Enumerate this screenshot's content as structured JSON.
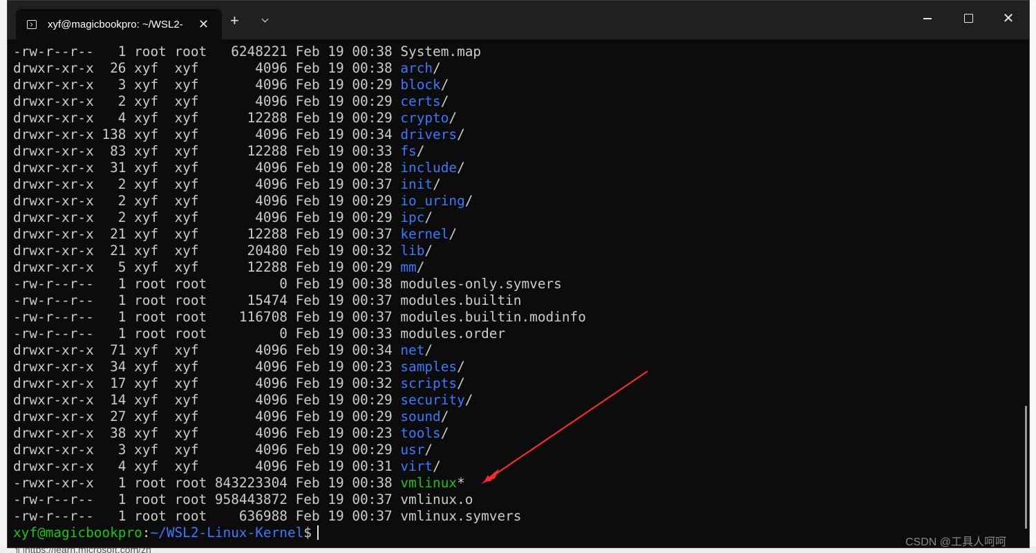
{
  "window": {
    "tab_title": "xyf@magicbookpro: ~/WSL2-",
    "tab_close": "✕",
    "new_tab": "+",
    "close": "✕",
    "icons": [
      "terminal-icon",
      "close-icon",
      "plus-icon",
      "chevron-down-icon",
      "minimize-icon",
      "maximize-icon",
      "close-icon"
    ]
  },
  "listing": [
    {
      "perms": "-rw-r--r-- ",
      "links": "  1",
      "owner": "root",
      "group": "root",
      "size": "  6248221",
      "date": "Feb 19 00:38",
      "name": "System.map",
      "suffix": "",
      "kind": "file"
    },
    {
      "perms": "drwxr-xr-x ",
      "links": " 26",
      "owner": "xyf ",
      "group": "xyf ",
      "size": "     4096",
      "date": "Feb 19 00:38",
      "name": "arch",
      "suffix": "/",
      "kind": "dir"
    },
    {
      "perms": "drwxr-xr-x ",
      "links": "  3",
      "owner": "xyf ",
      "group": "xyf ",
      "size": "     4096",
      "date": "Feb 19 00:29",
      "name": "block",
      "suffix": "/",
      "kind": "dir"
    },
    {
      "perms": "drwxr-xr-x ",
      "links": "  2",
      "owner": "xyf ",
      "group": "xyf ",
      "size": "     4096",
      "date": "Feb 19 00:29",
      "name": "certs",
      "suffix": "/",
      "kind": "dir"
    },
    {
      "perms": "drwxr-xr-x ",
      "links": "  4",
      "owner": "xyf ",
      "group": "xyf ",
      "size": "    12288",
      "date": "Feb 19 00:29",
      "name": "crypto",
      "suffix": "/",
      "kind": "dir"
    },
    {
      "perms": "drwxr-xr-x ",
      "links": "138",
      "owner": "xyf ",
      "group": "xyf ",
      "size": "     4096",
      "date": "Feb 19 00:34",
      "name": "drivers",
      "suffix": "/",
      "kind": "dir"
    },
    {
      "perms": "drwxr-xr-x ",
      "links": " 83",
      "owner": "xyf ",
      "group": "xyf ",
      "size": "    12288",
      "date": "Feb 19 00:33",
      "name": "fs",
      "suffix": "/",
      "kind": "dir"
    },
    {
      "perms": "drwxr-xr-x ",
      "links": " 31",
      "owner": "xyf ",
      "group": "xyf ",
      "size": "     4096",
      "date": "Feb 19 00:28",
      "name": "include",
      "suffix": "/",
      "kind": "dir"
    },
    {
      "perms": "drwxr-xr-x ",
      "links": "  2",
      "owner": "xyf ",
      "group": "xyf ",
      "size": "     4096",
      "date": "Feb 19 00:37",
      "name": "init",
      "suffix": "/",
      "kind": "dir"
    },
    {
      "perms": "drwxr-xr-x ",
      "links": "  2",
      "owner": "xyf ",
      "group": "xyf ",
      "size": "     4096",
      "date": "Feb 19 00:29",
      "name": "io_uring",
      "suffix": "/",
      "kind": "dir"
    },
    {
      "perms": "drwxr-xr-x ",
      "links": "  2",
      "owner": "xyf ",
      "group": "xyf ",
      "size": "     4096",
      "date": "Feb 19 00:29",
      "name": "ipc",
      "suffix": "/",
      "kind": "dir"
    },
    {
      "perms": "drwxr-xr-x ",
      "links": " 21",
      "owner": "xyf ",
      "group": "xyf ",
      "size": "    12288",
      "date": "Feb 19 00:37",
      "name": "kernel",
      "suffix": "/",
      "kind": "dir"
    },
    {
      "perms": "drwxr-xr-x ",
      "links": " 21",
      "owner": "xyf ",
      "group": "xyf ",
      "size": "    20480",
      "date": "Feb 19 00:32",
      "name": "lib",
      "suffix": "/",
      "kind": "dir"
    },
    {
      "perms": "drwxr-xr-x ",
      "links": "  5",
      "owner": "xyf ",
      "group": "xyf ",
      "size": "    12288",
      "date": "Feb 19 00:29",
      "name": "mm",
      "suffix": "/",
      "kind": "dir"
    },
    {
      "perms": "-rw-r--r-- ",
      "links": "  1",
      "owner": "root",
      "group": "root",
      "size": "        0",
      "date": "Feb 19 00:38",
      "name": "modules-only.symvers",
      "suffix": "",
      "kind": "file"
    },
    {
      "perms": "-rw-r--r-- ",
      "links": "  1",
      "owner": "root",
      "group": "root",
      "size": "    15474",
      "date": "Feb 19 00:37",
      "name": "modules.builtin",
      "suffix": "",
      "kind": "file"
    },
    {
      "perms": "-rw-r--r-- ",
      "links": "  1",
      "owner": "root",
      "group": "root",
      "size": "   116708",
      "date": "Feb 19 00:37",
      "name": "modules.builtin.modinfo",
      "suffix": "",
      "kind": "file"
    },
    {
      "perms": "-rw-r--r-- ",
      "links": "  1",
      "owner": "root",
      "group": "root",
      "size": "        0",
      "date": "Feb 19 00:33",
      "name": "modules.order",
      "suffix": "",
      "kind": "file"
    },
    {
      "perms": "drwxr-xr-x ",
      "links": " 71",
      "owner": "xyf ",
      "group": "xyf ",
      "size": "     4096",
      "date": "Feb 19 00:34",
      "name": "net",
      "suffix": "/",
      "kind": "dir"
    },
    {
      "perms": "drwxr-xr-x ",
      "links": " 34",
      "owner": "xyf ",
      "group": "xyf ",
      "size": "     4096",
      "date": "Feb 19 00:23",
      "name": "samples",
      "suffix": "/",
      "kind": "dir"
    },
    {
      "perms": "drwxr-xr-x ",
      "links": " 17",
      "owner": "xyf ",
      "group": "xyf ",
      "size": "     4096",
      "date": "Feb 19 00:32",
      "name": "scripts",
      "suffix": "/",
      "kind": "dir"
    },
    {
      "perms": "drwxr-xr-x ",
      "links": " 14",
      "owner": "xyf ",
      "group": "xyf ",
      "size": "     4096",
      "date": "Feb 19 00:29",
      "name": "security",
      "suffix": "/",
      "kind": "dir"
    },
    {
      "perms": "drwxr-xr-x ",
      "links": " 27",
      "owner": "xyf ",
      "group": "xyf ",
      "size": "     4096",
      "date": "Feb 19 00:29",
      "name": "sound",
      "suffix": "/",
      "kind": "dir"
    },
    {
      "perms": "drwxr-xr-x ",
      "links": " 38",
      "owner": "xyf ",
      "group": "xyf ",
      "size": "     4096",
      "date": "Feb 19 00:23",
      "name": "tools",
      "suffix": "/",
      "kind": "dir"
    },
    {
      "perms": "drwxr-xr-x ",
      "links": "  3",
      "owner": "xyf ",
      "group": "xyf ",
      "size": "     4096",
      "date": "Feb 19 00:29",
      "name": "usr",
      "suffix": "/",
      "kind": "dir"
    },
    {
      "perms": "drwxr-xr-x ",
      "links": "  4",
      "owner": "xyf ",
      "group": "xyf ",
      "size": "     4096",
      "date": "Feb 19 00:31",
      "name": "virt",
      "suffix": "/",
      "kind": "dir"
    },
    {
      "perms": "-rwxr-xr-x ",
      "links": "  1",
      "owner": "root",
      "group": "root",
      "size": "843223304",
      "date": "Feb 19 00:38",
      "name": "vmlinux",
      "suffix": "*",
      "kind": "exe"
    },
    {
      "perms": "-rw-r--r-- ",
      "links": "  1",
      "owner": "root",
      "group": "root",
      "size": "958443872",
      "date": "Feb 19 00:37",
      "name": "vmlinux.o",
      "suffix": "",
      "kind": "file"
    },
    {
      "perms": "-rw-r--r-- ",
      "links": "  1",
      "owner": "root",
      "group": "root",
      "size": "   636988",
      "date": "Feb 19 00:37",
      "name": "vmlinux.symvers",
      "suffix": "",
      "kind": "file"
    }
  ],
  "prompt": {
    "user_host": "xyf@magicbookpro",
    "separator": ":",
    "path": "~/WSL2-Linux-Kernel",
    "symbol": "$"
  },
  "annotation": {
    "color": "#ff2a2a"
  },
  "watermark": "CSDN @工具人呵呵",
  "background": {
    "bottom_text": "们https://learn.microsoft.com/zh"
  },
  "colors": {
    "background": "#0c0c0c",
    "text": "#cccccc",
    "directory": "#3b78ff",
    "executable": "#16c60c"
  }
}
